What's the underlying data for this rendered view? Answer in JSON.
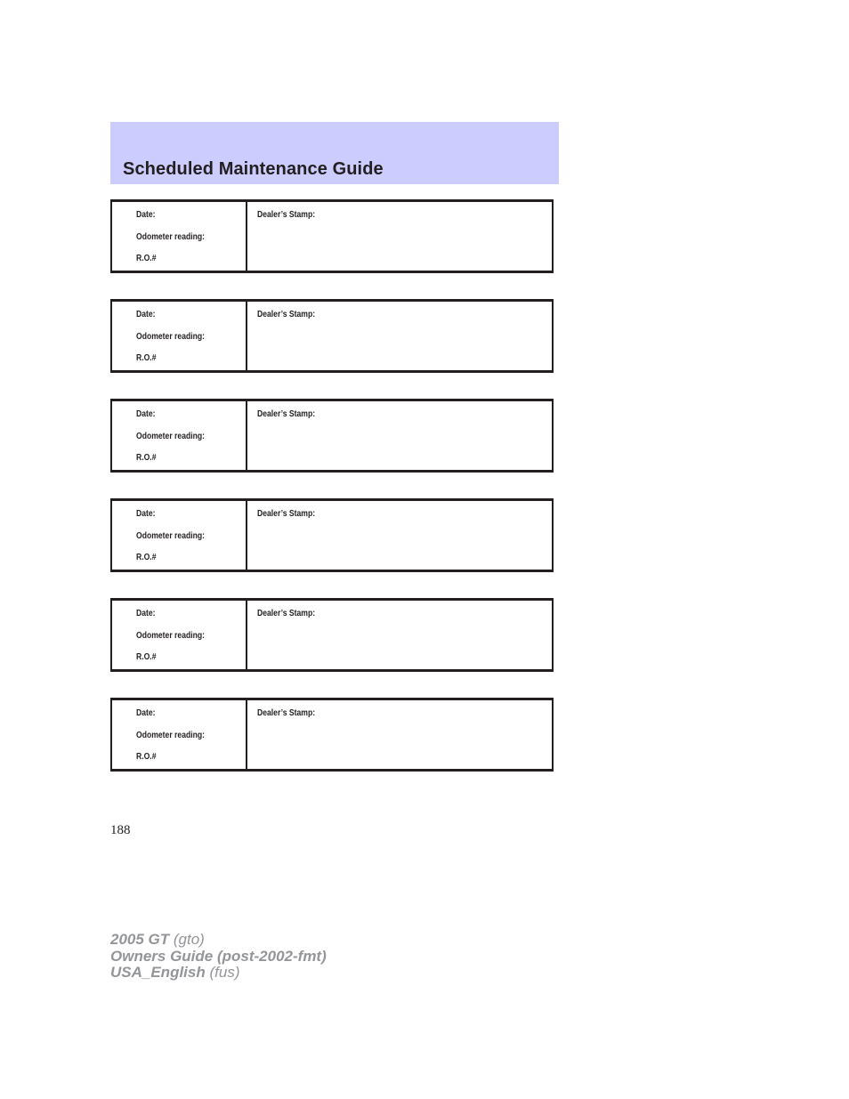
{
  "header": {
    "title": "Scheduled Maintenance Guide",
    "band_color": "#ccccff"
  },
  "records": [
    {
      "date_label": "Date:",
      "odometer_label": "Odometer reading:",
      "ro_label": "R.O.#",
      "stamp_label": "Dealer’s Stamp:"
    },
    {
      "date_label": "Date:",
      "odometer_label": "Odometer reading:",
      "ro_label": "R.O.#",
      "stamp_label": "Dealer’s Stamp:"
    },
    {
      "date_label": "Date:",
      "odometer_label": "Odometer reading:",
      "ro_label": "R.O.#",
      "stamp_label": "Dealer’s Stamp:"
    },
    {
      "date_label": "Date:",
      "odometer_label": "Odometer reading:",
      "ro_label": "R.O.#",
      "stamp_label": "Dealer’s Stamp:"
    },
    {
      "date_label": "Date:",
      "odometer_label": "Odometer reading:",
      "ro_label": "R.O.#",
      "stamp_label": "Dealer’s Stamp:"
    },
    {
      "date_label": "Date:",
      "odometer_label": "Odometer reading:",
      "ro_label": "R.O.#",
      "stamp_label": "Dealer’s Stamp:"
    }
  ],
  "page_number": "188",
  "footer": {
    "line1_bold": "2005 GT",
    "line1_italic": "(gto)",
    "line2_bold": "Owners Guide (post-2002-fmt)",
    "line3_bold": "USA_English",
    "line3_italic": "(fus)"
  }
}
